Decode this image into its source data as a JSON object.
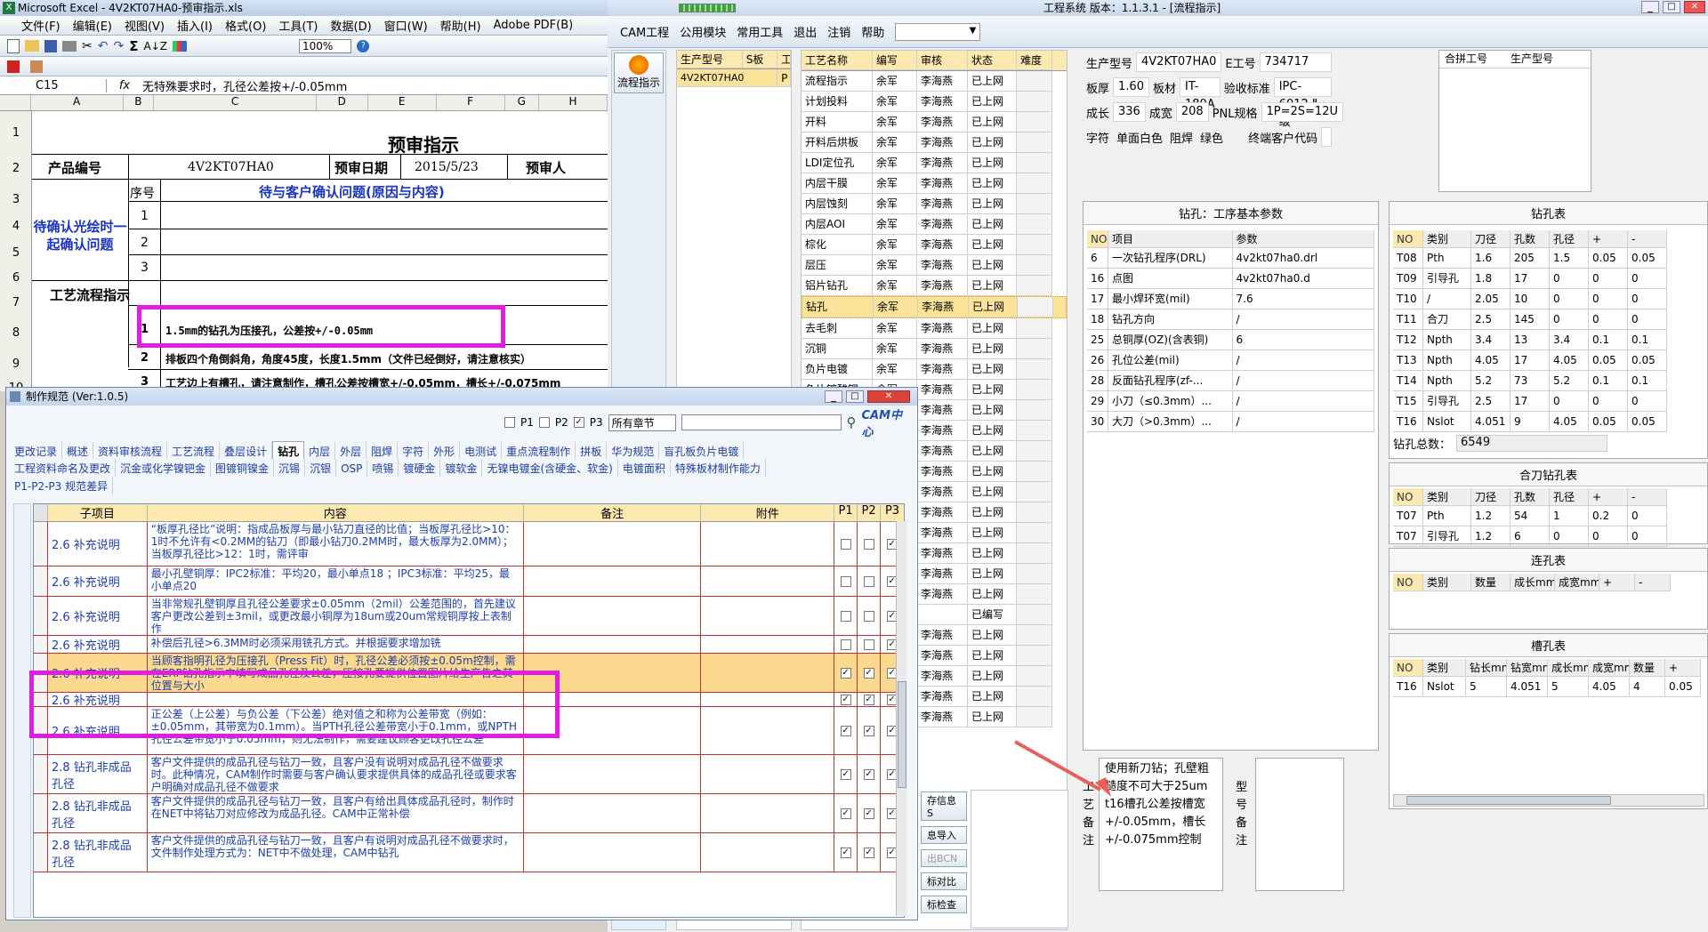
{
  "excel": {
    "title": "Microsoft Excel - 4V2KT07HA0-预审指示.xls",
    "menu": [
      "文件(F)",
      "编辑(E)",
      "视图(V)",
      "插入(I)",
      "格式(O)",
      "工具(T)",
      "数据(D)",
      "窗口(W)",
      "帮助(H)",
      "Adobe PDF(B)"
    ],
    "zoom": "100%",
    "name_box": "C15",
    "formula": "无特殊要求时，孔径公差按+/-0.05mm",
    "col_headers": [
      "A",
      "B",
      "C",
      "D",
      "E",
      "F",
      "G",
      "H"
    ],
    "row_headers": [
      "1",
      "2",
      "3",
      "4",
      "5",
      "6",
      "7",
      "8",
      "9",
      "10"
    ],
    "sheet_title": "预审指示",
    "product_no_label": "产品编号",
    "product_no": "4V2KT07HA0",
    "date_label": "预审日期",
    "date": "2015/5/23",
    "person_label": "预审人",
    "confirm_label": "待确认光绘时一起确认问题",
    "seq_label": "序号",
    "issue_header": "待与客户确认问题(原因与内容)",
    "seq": [
      "1",
      "2",
      "3"
    ],
    "process_label": "工艺流程指示",
    "proc_rows": [
      {
        "no": "1",
        "text": "1.5mm的钻孔为压接孔，公差按+/-0.05mm"
      },
      {
        "no": "2",
        "text": "排板四个角倒斜角，角度45度，长度1.5mm（文件已经倒好，请注意核实）"
      },
      {
        "no": "3",
        "text": "工艺边上有槽孔，请注意制作，槽孔公差按槽宽+/-0.05mm，槽长+/-0.075mm"
      }
    ]
  },
  "cam": {
    "menu": [
      "CAM工程",
      "公用模块",
      "常用工具",
      "退出",
      "注销",
      "帮助"
    ],
    "title": "工程系统  版本：1.1.3.1 - [流程指示]",
    "left_button": "流程指示",
    "model_header": [
      "生产型号",
      "S板",
      "工"
    ],
    "model_row": [
      "4V2KT07HA0",
      "P"
    ],
    "process_header": [
      "工艺名称",
      "编写",
      "审核",
      "状态",
      "难度"
    ],
    "processes": [
      [
        "流程指示",
        "余军",
        "李海燕",
        "已上网"
      ],
      [
        "计划投料",
        "余军",
        "李海燕",
        "已上网"
      ],
      [
        "开料",
        "余军",
        "李海燕",
        "已上网"
      ],
      [
        "开料后烘板",
        "余军",
        "李海燕",
        "已上网"
      ],
      [
        "LDI定位孔",
        "余军",
        "李海燕",
        "已上网"
      ],
      [
        "内层干膜",
        "余军",
        "李海燕",
        "已上网"
      ],
      [
        "内层蚀刻",
        "余军",
        "李海燕",
        "已上网"
      ],
      [
        "内层AOI",
        "余军",
        "李海燕",
        "已上网"
      ],
      [
        "棕化",
        "余军",
        "李海燕",
        "已上网"
      ],
      [
        "层压",
        "余军",
        "李海燕",
        "已上网"
      ],
      [
        "铝片钻孔",
        "余军",
        "李海燕",
        "已上网"
      ],
      [
        "钻孔",
        "余军",
        "李海燕",
        "已上网"
      ],
      [
        "去毛刺",
        "余军",
        "李海燕",
        "已上网"
      ],
      [
        "沉铜",
        "余军",
        "李海燕",
        "已上网"
      ],
      [
        "负片电镀",
        "余军",
        "李海燕",
        "已上网"
      ],
      [
        "负片镀酸铜",
        "余军",
        "李海燕",
        "已上网"
      ],
      [
        "",
        "余军",
        "李海燕",
        "已上网"
      ],
      [
        "",
        "余军",
        "李海燕",
        "已上网"
      ],
      [
        "",
        "余军",
        "李海燕",
        "已上网"
      ],
      [
        "",
        "余军",
        "李海燕",
        "已上网"
      ],
      [
        "",
        "余军",
        "李海燕",
        "已上网"
      ],
      [
        "",
        "余军",
        "李海燕",
        "已上网"
      ],
      [
        "",
        "余军",
        "李海燕",
        "已上网"
      ],
      [
        "",
        "余军",
        "李海燕",
        "已上网"
      ],
      [
        "",
        "余军",
        "李海燕",
        "已上网"
      ],
      [
        "",
        "余军",
        "李海燕",
        "已上网"
      ],
      [
        "",
        "",
        "",
        "已编写"
      ],
      [
        "",
        "余军",
        "李海燕",
        "已上网"
      ],
      [
        "",
        "余军",
        "李海燕",
        "已上网"
      ],
      [
        "",
        "余军",
        "李海燕",
        "已上网"
      ],
      [
        "",
        "余军",
        "李海燕",
        "已上网"
      ],
      [
        "",
        "余军",
        "李海燕",
        "已上网"
      ]
    ],
    "info": {
      "model_label": "生产型号",
      "model": "4V2KT07HA0",
      "eno_label": "E工号",
      "eno": "734717",
      "thick_label": "板厚",
      "thick": "1.60",
      "mat_label": "板材",
      "mat": "IT-180A",
      "std_label": "验收标准",
      "std": "IPC-6012 Ⅱ级",
      "len_label": "成长",
      "len": "336",
      "wid_label": "成宽",
      "wid": "208",
      "pnl_label": "PNL规格",
      "pnl": "1P=2S=12U",
      "char_label": "字符",
      "char": "单面白色",
      "mask_label": "阻焊",
      "mask": "绿色",
      "cust_label": "终端客户代码",
      "merge_h1": "合拼工号",
      "merge_h2": "生产型号"
    },
    "drill_params_title": "钻孔：工序基本参数",
    "drill_params_header": [
      "NO",
      "项目",
      "参数"
    ],
    "drill_params": [
      [
        "6",
        "一次钻孔程序(DRL)",
        "4v2kt07ha0.drl"
      ],
      [
        "16",
        "点图",
        "4v2kt07ha0.d"
      ],
      [
        "17",
        "最小焊环宽(mil)",
        "7.6"
      ],
      [
        "18",
        "钻孔方向",
        "/"
      ],
      [
        "25",
        "总铜厚(OZ)(含表铜)",
        "6"
      ],
      [
        "26",
        "孔位公差(mil)",
        "/"
      ],
      [
        "28",
        "反面钻孔程序(zf-...",
        "/"
      ],
      [
        "29",
        "小刀（≤0.3mm）...",
        "/"
      ],
      [
        "30",
        "大刀（>0.3mm）...",
        "/"
      ]
    ],
    "hole_table_title": "钻孔表",
    "hole_header": [
      "NO",
      "类别",
      "刀径",
      "孔数",
      "孔径",
      "+",
      "-"
    ],
    "holes": [
      [
        "T08",
        "Pth",
        "1.6",
        "205",
        "1.5",
        "0.05",
        "0.05"
      ],
      [
        "T09",
        "引导孔",
        "1.8",
        "17",
        "0",
        "0",
        "0"
      ],
      [
        "T10",
        "/",
        "2.05",
        "10",
        "0",
        "0",
        "0"
      ],
      [
        "T11",
        "合刀",
        "2.5",
        "145",
        "0",
        "0",
        "0"
      ],
      [
        "T12",
        "Npth",
        "3.4",
        "13",
        "3.4",
        "0.1",
        "0.1"
      ],
      [
        "T13",
        "Npth",
        "4.05",
        "17",
        "4.05",
        "0.05",
        "0.05"
      ],
      [
        "T14",
        "Npth",
        "5.2",
        "73",
        "5.2",
        "0.1",
        "0.1"
      ],
      [
        "T15",
        "引导孔",
        "2.5",
        "17",
        "0",
        "0",
        "0"
      ],
      [
        "T16",
        "Nslot",
        "4.051",
        "9",
        "4.05",
        "0.05",
        "0.05"
      ]
    ],
    "total_label": "钻孔总数：",
    "total": "6549",
    "combo_title": "合刀钻孔表",
    "combo_header": [
      "NO",
      "类别",
      "刀径",
      "孔数",
      "孔径",
      "+",
      "-"
    ],
    "combo": [
      [
        "T07",
        "Pth",
        "1.2",
        "54",
        "1",
        "0.2",
        "0"
      ],
      [
        "T07",
        "引导孔",
        "1.2",
        "6",
        "0",
        "0",
        "0"
      ]
    ],
    "link_title": "连孔表",
    "link_header": [
      "NO",
      "类别",
      "数量",
      "成长mm",
      "成宽mm",
      "+",
      "-"
    ],
    "slot_title": "槽孔表",
    "slot_header": [
      "NO",
      "类别",
      "钻长mm",
      "钻宽mm",
      "成长mm",
      "成宽mm",
      "数量",
      "+"
    ],
    "slots": [
      [
        "T16",
        "Nslot",
        "5",
        "4.051",
        "5",
        "4.05",
        "4",
        "0.05"
      ]
    ],
    "note_label": "工艺备注",
    "note_text": "使用新刀钻；孔壁粗糙度不可大于25um\nt16槽孔公差按槽宽+/-0.05mm，槽长+/-0.075mm控制",
    "note_label2": "型号备注",
    "side_buttons": [
      "存信息S",
      "息导入",
      "出BCN",
      "标对比",
      "标检查"
    ]
  },
  "spec": {
    "title": "制作规范 (Ver:1.0.5)",
    "filters": [
      "P1",
      "P2",
      "P3"
    ],
    "section_select": "所有章节",
    "tabs1": [
      "更改记录",
      "概述",
      "资料审核流程",
      "工艺流程",
      "叠层设计",
      "钻孔",
      "内层",
      "外层",
      "阻焊",
      "字符",
      "外形",
      "电测试",
      "重点流程制作",
      "拼板",
      "华为规范",
      "盲孔板负片电镀"
    ],
    "tabs2": [
      "工程资料命名及更改",
      "沉金或化学镍钯金",
      "图镀铜镍金",
      "沉锡",
      "沉银",
      "OSP",
      "喷锡",
      "镀硬金",
      "镀软金",
      "无镍电镀金(含硬金、软金)",
      "电镀面积",
      "特殊板材制作能力"
    ],
    "tabs3": [
      "P1-P2-P3 规范差异"
    ],
    "header": [
      "子项目",
      "内容",
      "备注",
      "附件",
      "P1",
      "P2",
      "P3"
    ],
    "rows": [
      {
        "sub": "2.6 补充说明",
        "content": "“板厚孔径比”说明：指成品板厚与最小钻刀直径的比值；当板厚孔径比>10：1时不允许有<0.2MM的钻刀（即最小钻刀0.2MM时，最大板厚为2.0MM）；当板厚孔径比>12：1时，需评审",
        "p": [
          false,
          false,
          true
        ]
      },
      {
        "sub": "2.6 补充说明",
        "content": "最小孔壁铜厚：IPC2标准：平均20，最小单点18 ；IPC3标准：平均25，最小单点20",
        "p": [
          false,
          false,
          true
        ]
      },
      {
        "sub": "2.6 补充说明",
        "content": "当非常规孔壁铜厚且孔径公差要求±0.05mm（2mil）公差范围的，首先建议客户更改公差到±3mil，或更改最小铜厚为18um或20um常规铜厚按上表制作",
        "p": [
          false,
          false,
          true
        ]
      },
      {
        "sub": "2.6 补充说明",
        "content": "补偿后孔径>6.3MM时必须采用铣孔方式。并根据要求增加铣",
        "p": [
          false,
          false,
          true
        ]
      },
      {
        "sub": "2.6 补充说明",
        "content": "当顾客指明孔径为压接孔（Press Fit）时，孔径公差必须按±0.05m控制，需在ERP钻孔指示中填写成品孔径及公差，压接孔要提供位置图片给生产告之其位置与大小",
        "p": [
          true,
          true,
          true
        ],
        "hl": true
      },
      {
        "sub": "2.6 补充说明",
        "content": "",
        "p": [
          true,
          true,
          true
        ]
      },
      {
        "sub": "2.6 补充说明",
        "content": "正公差（上公差）与负公差（下公差）绝对值之和称为公差带宽（例如：±0.05mm，其带宽为0.1mm）。当PTH孔径公差带宽小于0.1mm，或NPTH孔径公差带宽小于0.05mm，则无法制作，需要建议顾客更改孔径公差",
        "p": [
          true,
          true,
          true
        ]
      },
      {
        "sub": "2.8 钻孔非成品孔径",
        "content": "客户文件提供的成品孔径与钻刀一致，且客户没有说明对成品孔径不做要求时。此种情况，CAM制作时需要与客户确认要求提供具体的成品孔径或要求客户明确对成品孔径不做要求",
        "p": [
          true,
          true,
          true
        ]
      },
      {
        "sub": "2.8 钻孔非成品孔径",
        "content": "客户文件提供的成品孔径与钻刀一致，且客户有给出具体成品孔径时，制作时在NET中将钻刀对应修改为成品孔径。CAM中正常补偿",
        "p": [
          true,
          true,
          true
        ]
      },
      {
        "sub": "2.8 钻孔非成品孔径",
        "content": "客户文件提供的成品孔径与钻刀一致，且客户有说明对成品孔径不做要求时，文件制作处理方式为：NET中不做处理，CAM中钻孔",
        "p": [
          true,
          true,
          true
        ]
      }
    ]
  }
}
